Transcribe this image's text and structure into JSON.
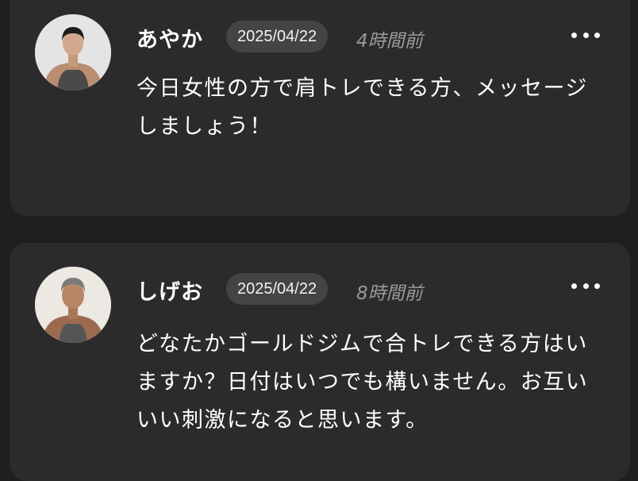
{
  "posts": [
    {
      "author": "あやか",
      "date": "2025/04/22",
      "time_ago": "4時間前",
      "message": "今日女性の方で肩トレできる方、メッセージしましょう！",
      "more_icon": "more-horizontal-icon"
    },
    {
      "author": "しげお",
      "date": "2025/04/22",
      "time_ago": "8時間前",
      "message": "どなたかゴールドジムで合トレできる方はいますか？日付はいつでも構いません。お互いいい刺激になると思います。",
      "more_icon": "more-horizontal-icon"
    }
  ],
  "colors": {
    "background": "#1f1f1f",
    "card": "#2b2b2b",
    "date_badge": "#444444",
    "muted_text": "#9a9a9a"
  }
}
